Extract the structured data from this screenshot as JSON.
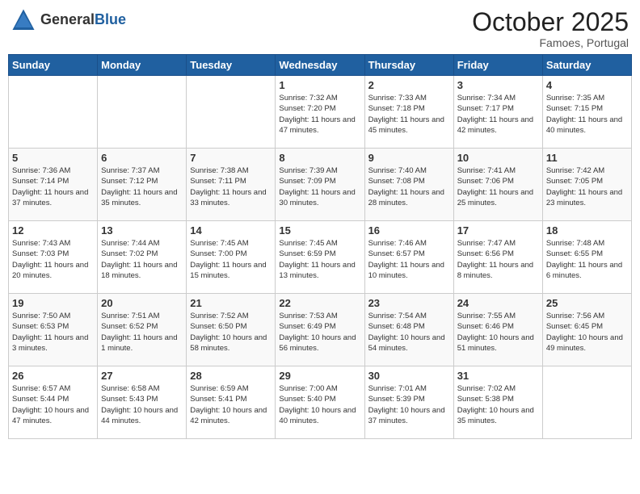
{
  "header": {
    "logo_general": "General",
    "logo_blue": "Blue",
    "month": "October 2025",
    "location": "Famoes, Portugal"
  },
  "weekdays": [
    "Sunday",
    "Monday",
    "Tuesday",
    "Wednesday",
    "Thursday",
    "Friday",
    "Saturday"
  ],
  "weeks": [
    [
      {
        "day": "",
        "sunrise": "",
        "sunset": "",
        "daylight": ""
      },
      {
        "day": "",
        "sunrise": "",
        "sunset": "",
        "daylight": ""
      },
      {
        "day": "",
        "sunrise": "",
        "sunset": "",
        "daylight": ""
      },
      {
        "day": "1",
        "sunrise": "Sunrise: 7:32 AM",
        "sunset": "Sunset: 7:20 PM",
        "daylight": "Daylight: 11 hours and 47 minutes."
      },
      {
        "day": "2",
        "sunrise": "Sunrise: 7:33 AM",
        "sunset": "Sunset: 7:18 PM",
        "daylight": "Daylight: 11 hours and 45 minutes."
      },
      {
        "day": "3",
        "sunrise": "Sunrise: 7:34 AM",
        "sunset": "Sunset: 7:17 PM",
        "daylight": "Daylight: 11 hours and 42 minutes."
      },
      {
        "day": "4",
        "sunrise": "Sunrise: 7:35 AM",
        "sunset": "Sunset: 7:15 PM",
        "daylight": "Daylight: 11 hours and 40 minutes."
      }
    ],
    [
      {
        "day": "5",
        "sunrise": "Sunrise: 7:36 AM",
        "sunset": "Sunset: 7:14 PM",
        "daylight": "Daylight: 11 hours and 37 minutes."
      },
      {
        "day": "6",
        "sunrise": "Sunrise: 7:37 AM",
        "sunset": "Sunset: 7:12 PM",
        "daylight": "Daylight: 11 hours and 35 minutes."
      },
      {
        "day": "7",
        "sunrise": "Sunrise: 7:38 AM",
        "sunset": "Sunset: 7:11 PM",
        "daylight": "Daylight: 11 hours and 33 minutes."
      },
      {
        "day": "8",
        "sunrise": "Sunrise: 7:39 AM",
        "sunset": "Sunset: 7:09 PM",
        "daylight": "Daylight: 11 hours and 30 minutes."
      },
      {
        "day": "9",
        "sunrise": "Sunrise: 7:40 AM",
        "sunset": "Sunset: 7:08 PM",
        "daylight": "Daylight: 11 hours and 28 minutes."
      },
      {
        "day": "10",
        "sunrise": "Sunrise: 7:41 AM",
        "sunset": "Sunset: 7:06 PM",
        "daylight": "Daylight: 11 hours and 25 minutes."
      },
      {
        "day": "11",
        "sunrise": "Sunrise: 7:42 AM",
        "sunset": "Sunset: 7:05 PM",
        "daylight": "Daylight: 11 hours and 23 minutes."
      }
    ],
    [
      {
        "day": "12",
        "sunrise": "Sunrise: 7:43 AM",
        "sunset": "Sunset: 7:03 PM",
        "daylight": "Daylight: 11 hours and 20 minutes."
      },
      {
        "day": "13",
        "sunrise": "Sunrise: 7:44 AM",
        "sunset": "Sunset: 7:02 PM",
        "daylight": "Daylight: 11 hours and 18 minutes."
      },
      {
        "day": "14",
        "sunrise": "Sunrise: 7:45 AM",
        "sunset": "Sunset: 7:00 PM",
        "daylight": "Daylight: 11 hours and 15 minutes."
      },
      {
        "day": "15",
        "sunrise": "Sunrise: 7:45 AM",
        "sunset": "Sunset: 6:59 PM",
        "daylight": "Daylight: 11 hours and 13 minutes."
      },
      {
        "day": "16",
        "sunrise": "Sunrise: 7:46 AM",
        "sunset": "Sunset: 6:57 PM",
        "daylight": "Daylight: 11 hours and 10 minutes."
      },
      {
        "day": "17",
        "sunrise": "Sunrise: 7:47 AM",
        "sunset": "Sunset: 6:56 PM",
        "daylight": "Daylight: 11 hours and 8 minutes."
      },
      {
        "day": "18",
        "sunrise": "Sunrise: 7:48 AM",
        "sunset": "Sunset: 6:55 PM",
        "daylight": "Daylight: 11 hours and 6 minutes."
      }
    ],
    [
      {
        "day": "19",
        "sunrise": "Sunrise: 7:50 AM",
        "sunset": "Sunset: 6:53 PM",
        "daylight": "Daylight: 11 hours and 3 minutes."
      },
      {
        "day": "20",
        "sunrise": "Sunrise: 7:51 AM",
        "sunset": "Sunset: 6:52 PM",
        "daylight": "Daylight: 11 hours and 1 minute."
      },
      {
        "day": "21",
        "sunrise": "Sunrise: 7:52 AM",
        "sunset": "Sunset: 6:50 PM",
        "daylight": "Daylight: 10 hours and 58 minutes."
      },
      {
        "day": "22",
        "sunrise": "Sunrise: 7:53 AM",
        "sunset": "Sunset: 6:49 PM",
        "daylight": "Daylight: 10 hours and 56 minutes."
      },
      {
        "day": "23",
        "sunrise": "Sunrise: 7:54 AM",
        "sunset": "Sunset: 6:48 PM",
        "daylight": "Daylight: 10 hours and 54 minutes."
      },
      {
        "day": "24",
        "sunrise": "Sunrise: 7:55 AM",
        "sunset": "Sunset: 6:46 PM",
        "daylight": "Daylight: 10 hours and 51 minutes."
      },
      {
        "day": "25",
        "sunrise": "Sunrise: 7:56 AM",
        "sunset": "Sunset: 6:45 PM",
        "daylight": "Daylight: 10 hours and 49 minutes."
      }
    ],
    [
      {
        "day": "26",
        "sunrise": "Sunrise: 6:57 AM",
        "sunset": "Sunset: 5:44 PM",
        "daylight": "Daylight: 10 hours and 47 minutes."
      },
      {
        "day": "27",
        "sunrise": "Sunrise: 6:58 AM",
        "sunset": "Sunset: 5:43 PM",
        "daylight": "Daylight: 10 hours and 44 minutes."
      },
      {
        "day": "28",
        "sunrise": "Sunrise: 6:59 AM",
        "sunset": "Sunset: 5:41 PM",
        "daylight": "Daylight: 10 hours and 42 minutes."
      },
      {
        "day": "29",
        "sunrise": "Sunrise: 7:00 AM",
        "sunset": "Sunset: 5:40 PM",
        "daylight": "Daylight: 10 hours and 40 minutes."
      },
      {
        "day": "30",
        "sunrise": "Sunrise: 7:01 AM",
        "sunset": "Sunset: 5:39 PM",
        "daylight": "Daylight: 10 hours and 37 minutes."
      },
      {
        "day": "31",
        "sunrise": "Sunrise: 7:02 AM",
        "sunset": "Sunset: 5:38 PM",
        "daylight": "Daylight: 10 hours and 35 minutes."
      },
      {
        "day": "",
        "sunrise": "",
        "sunset": "",
        "daylight": ""
      }
    ]
  ]
}
